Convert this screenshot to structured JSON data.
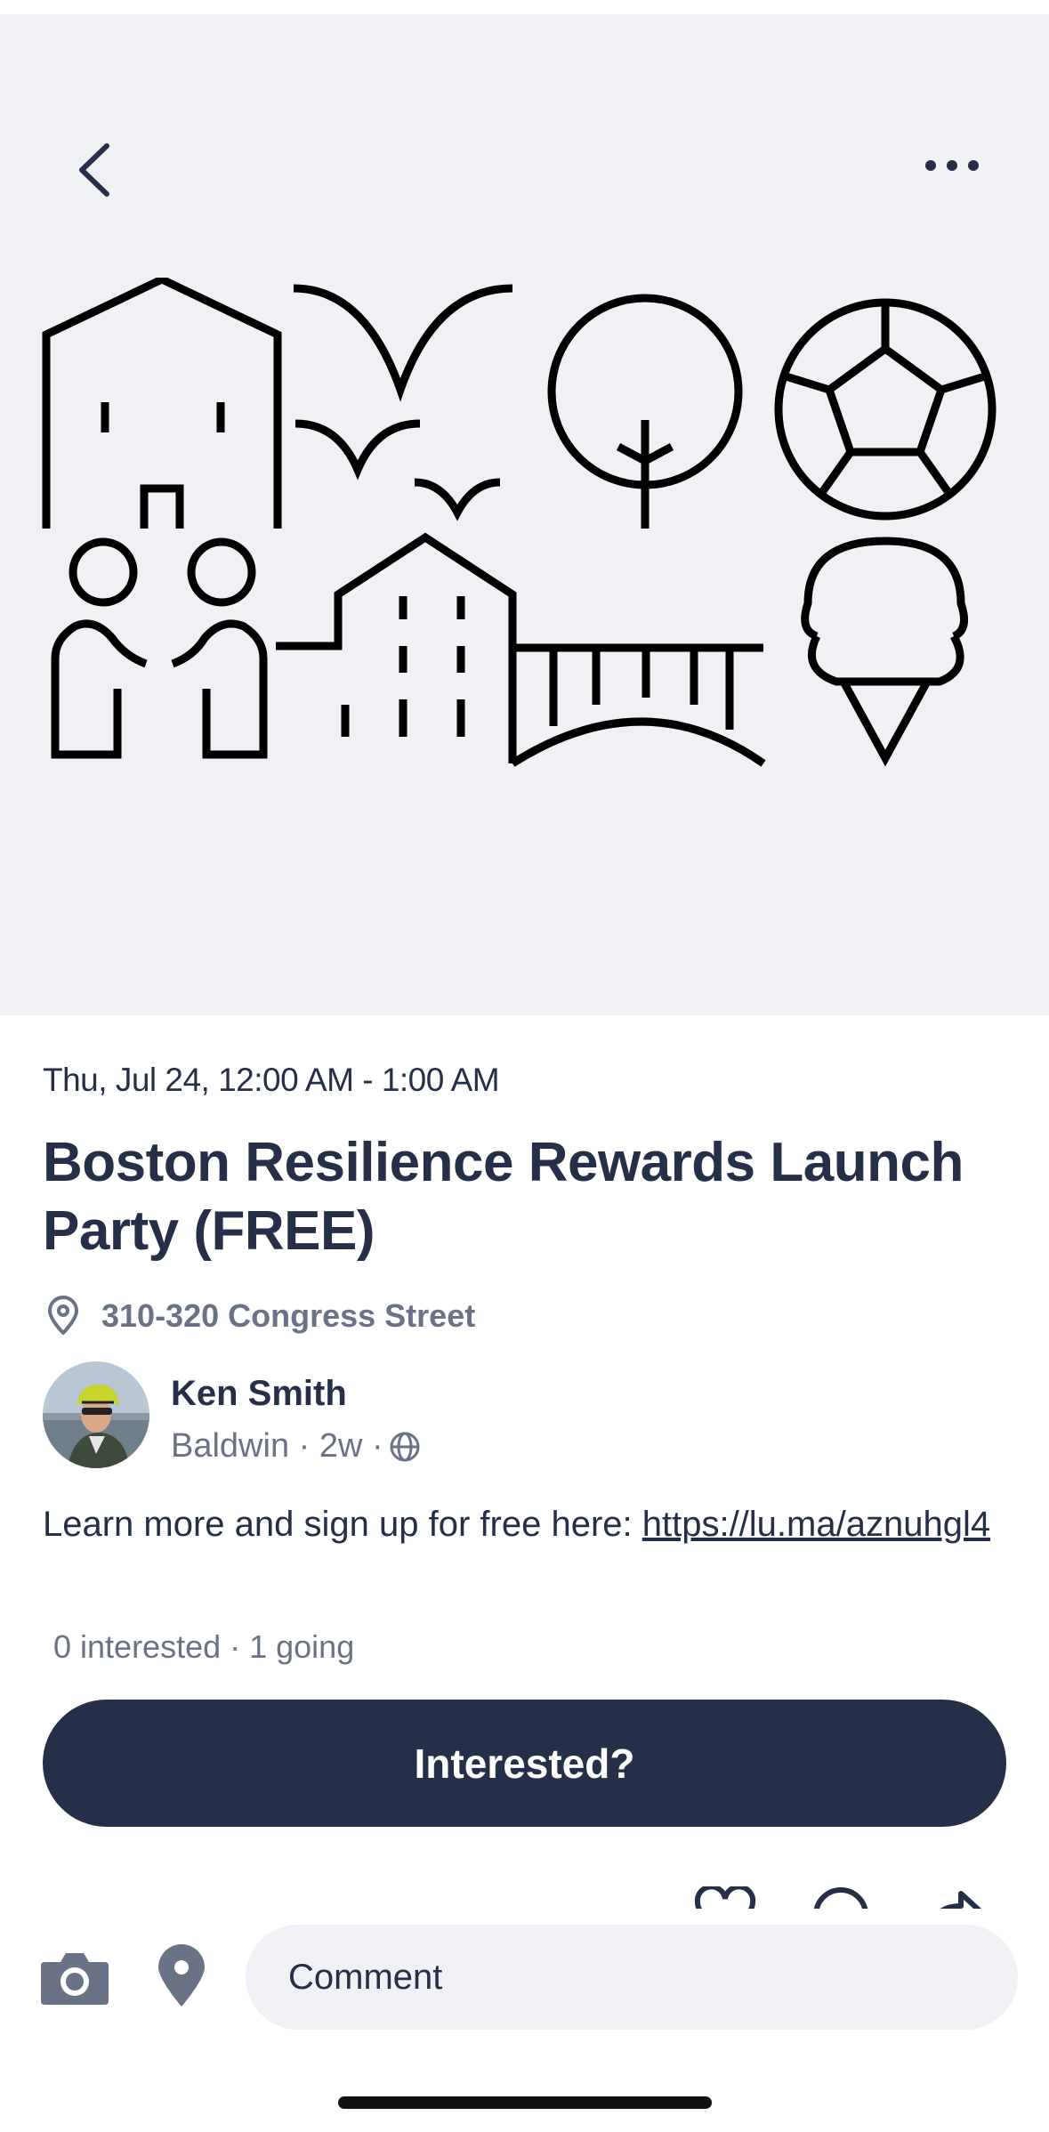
{
  "event": {
    "date": "Thu, Jul 24, 12:00 AM - 1:00 AM",
    "title": "Boston Resilience Rewards Launch Party (FREE)",
    "location": "310-320 Congress Street"
  },
  "author": {
    "name": "Ken Smith",
    "meta": "Baldwin · 2w ·"
  },
  "post": {
    "text": "Learn more and sign up for free here: ",
    "link": "https://lu.ma/aznuhgl4"
  },
  "counts": "0 interested · 1 going",
  "actions": {
    "interested_label": "Interested?"
  },
  "comment": {
    "placeholder": "Comment"
  },
  "icons": {
    "back": "chevron-left-icon",
    "more": "more-horizontal-icon",
    "location": "map-pin-icon",
    "privacy": "globe-icon",
    "like": "heart-icon",
    "reply": "comment-icon",
    "share": "share-icon",
    "camera": "camera-icon",
    "place": "location-icon"
  },
  "colors": {
    "primary": "#252f47",
    "secondary_text": "#6a7286",
    "hero_bg": "#f0f1f5",
    "button_bg": "#252f47",
    "button_text": "#ffffff"
  }
}
